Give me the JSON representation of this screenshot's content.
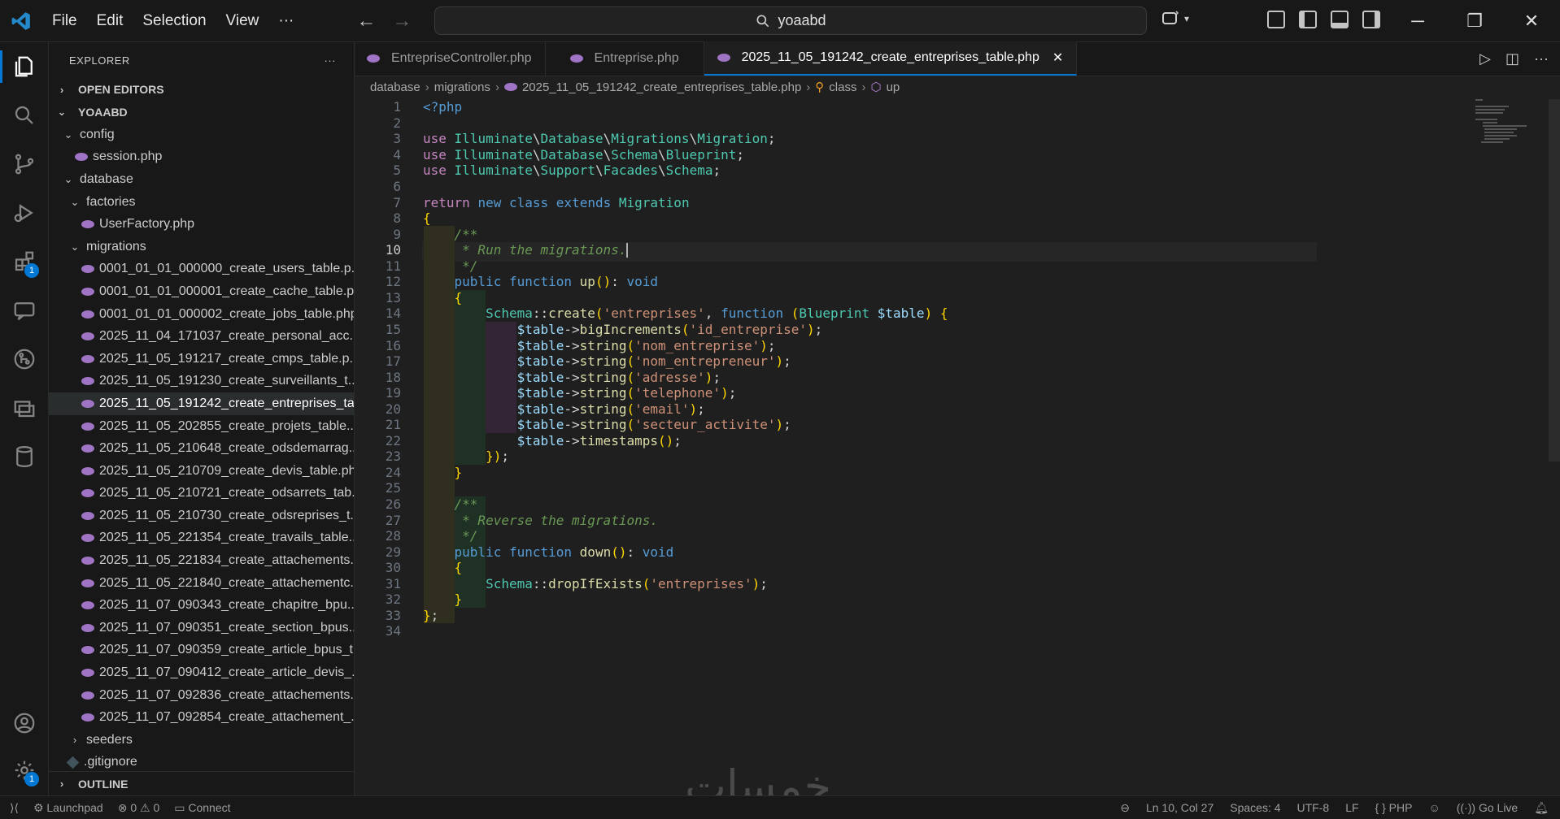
{
  "menu": [
    "File",
    "Edit",
    "Selection",
    "View",
    "···"
  ],
  "search": {
    "value": "yoaabd"
  },
  "explorer": {
    "title": "EXPLORER",
    "more": "···",
    "open_editors": "OPEN EDITORS",
    "root": "YOAABD",
    "outline": "OUTLINE"
  },
  "tree": [
    {
      "label": "config",
      "type": "folder-open",
      "depth": 1
    },
    {
      "label": "session.php",
      "type": "php",
      "depth": 2
    },
    {
      "label": "database",
      "type": "folder-open",
      "depth": 1
    },
    {
      "label": "factories",
      "type": "folder-open",
      "depth": 2
    },
    {
      "label": "UserFactory.php",
      "type": "php",
      "depth": 3
    },
    {
      "label": "migrations",
      "type": "folder-open",
      "depth": 2
    },
    {
      "label": "0001_01_01_000000_create_users_table.p...",
      "type": "php",
      "depth": 3
    },
    {
      "label": "0001_01_01_000001_create_cache_table.p...",
      "type": "php",
      "depth": 3
    },
    {
      "label": "0001_01_01_000002_create_jobs_table.php",
      "type": "php",
      "depth": 3
    },
    {
      "label": "2025_11_04_171037_create_personal_acc...",
      "type": "php",
      "depth": 3
    },
    {
      "label": "2025_11_05_191217_create_cmps_table.p...",
      "type": "php",
      "depth": 3
    },
    {
      "label": "2025_11_05_191230_create_surveillants_t...",
      "type": "php",
      "depth": 3
    },
    {
      "label": "2025_11_05_191242_create_entreprises_ta...",
      "type": "php",
      "depth": 3,
      "selected": true
    },
    {
      "label": "2025_11_05_202855_create_projets_table....",
      "type": "php",
      "depth": 3
    },
    {
      "label": "2025_11_05_210648_create_odsdemarrag...",
      "type": "php",
      "depth": 3
    },
    {
      "label": "2025_11_05_210709_create_devis_table.php",
      "type": "php",
      "depth": 3
    },
    {
      "label": "2025_11_05_210721_create_odsarrets_tab...",
      "type": "php",
      "depth": 3
    },
    {
      "label": "2025_11_05_210730_create_odsreprises_t...",
      "type": "php",
      "depth": 3
    },
    {
      "label": "2025_11_05_221354_create_travails_table....",
      "type": "php",
      "depth": 3
    },
    {
      "label": "2025_11_05_221834_create_attachements...",
      "type": "php",
      "depth": 3
    },
    {
      "label": "2025_11_05_221840_create_attachementc...",
      "type": "php",
      "depth": 3
    },
    {
      "label": "2025_11_07_090343_create_chapitre_bpu...",
      "type": "php",
      "depth": 3
    },
    {
      "label": "2025_11_07_090351_create_section_bpus...",
      "type": "php",
      "depth": 3
    },
    {
      "label": "2025_11_07_090359_create_article_bpus_t...",
      "type": "php",
      "depth": 3
    },
    {
      "label": "2025_11_07_090412_create_article_devis_...",
      "type": "php",
      "depth": 3
    },
    {
      "label": "2025_11_07_092836_create_attachements...",
      "type": "php",
      "depth": 3
    },
    {
      "label": "2025_11_07_092854_create_attachement_...",
      "type": "php",
      "depth": 3
    },
    {
      "label": "seeders",
      "type": "folder-closed",
      "depth": 2
    },
    {
      "label": ".gitignore",
      "type": "git",
      "depth": 1
    }
  ],
  "tabs": [
    {
      "label": "EntrepriseController.php",
      "active": false
    },
    {
      "label": "Entreprise.php",
      "active": false
    },
    {
      "label": "2025_11_05_191242_create_entreprises_table.php",
      "active": true,
      "close": "✕"
    }
  ],
  "breadcrumb": [
    "database",
    "migrations",
    "2025_11_05_191242_create_entreprises_table.php",
    "class",
    "up"
  ],
  "code": {
    "current_line": 10,
    "lines": [
      "<?php",
      "",
      "use Illuminate\\Database\\Migrations\\Migration;",
      "use Illuminate\\Database\\Schema\\Blueprint;",
      "use Illuminate\\Support\\Facades\\Schema;",
      "",
      "return new class extends Migration",
      "{",
      "    /**",
      "     * Run the migrations.",
      "     */",
      "    public function up(): void",
      "    {",
      "        Schema::create('entreprises', function (Blueprint $table) {",
      "            $table->bigIncrements('id_entreprise');",
      "            $table->string('nom_entreprise');",
      "            $table->string('nom_entrepreneur');",
      "            $table->string('adresse');",
      "            $table->string('telephone');",
      "            $table->string('email');",
      "            $table->string('secteur_activite');",
      "            $table->timestamps();",
      "        });",
      "    }",
      "",
      "    /**",
      "     * Reverse the migrations.",
      "     */",
      "    public function down(): void",
      "    {",
      "        Schema::dropIfExists('entreprises');",
      "    }",
      "};",
      ""
    ]
  },
  "status": {
    "launchpad": "Launchpad",
    "errors": "0",
    "warnings": "0",
    "connect": "Connect",
    "position": "Ln 10, Col 27",
    "spaces": "Spaces: 4",
    "encoding": "UTF-8",
    "eol": "LF",
    "language": "PHP",
    "golive": "Go Live"
  },
  "badges": {
    "extensions": "1",
    "settings": "1"
  },
  "watermark": "خمسات",
  "colors": {
    "accent": "#0078d4",
    "php_icon": "#a074c4"
  }
}
